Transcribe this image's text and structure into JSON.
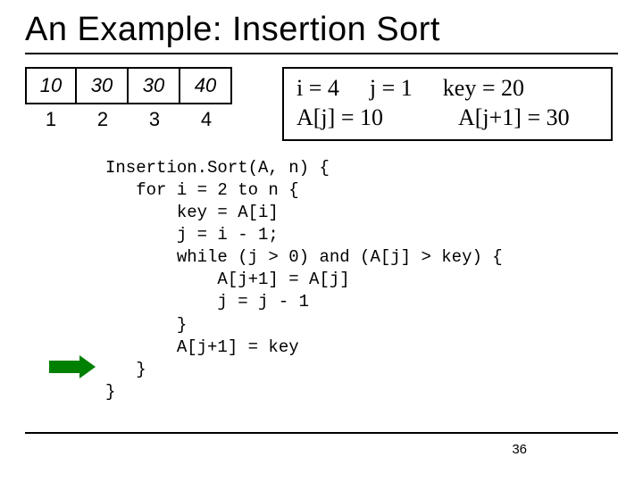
{
  "title": "An Example: Insertion Sort",
  "array": {
    "cells": [
      "10",
      "30",
      "30",
      "40"
    ],
    "indices": [
      "1",
      "2",
      "3",
      "4"
    ]
  },
  "state": {
    "i": "i = 4",
    "j": "j = 1",
    "key": "key = 20",
    "aj": "A[j] = 10",
    "aj1": "A[j+1] = 30"
  },
  "code": "Insertion.Sort(A, n) {\n   for i = 2 to n {\n       key = A[i]\n       j = i - 1;\n       while (j > 0) and (A[j] > key) {\n           A[j+1] = A[j]\n           j = j - 1\n       }\n       A[j+1] = key\n   }\n}",
  "page": "36"
}
